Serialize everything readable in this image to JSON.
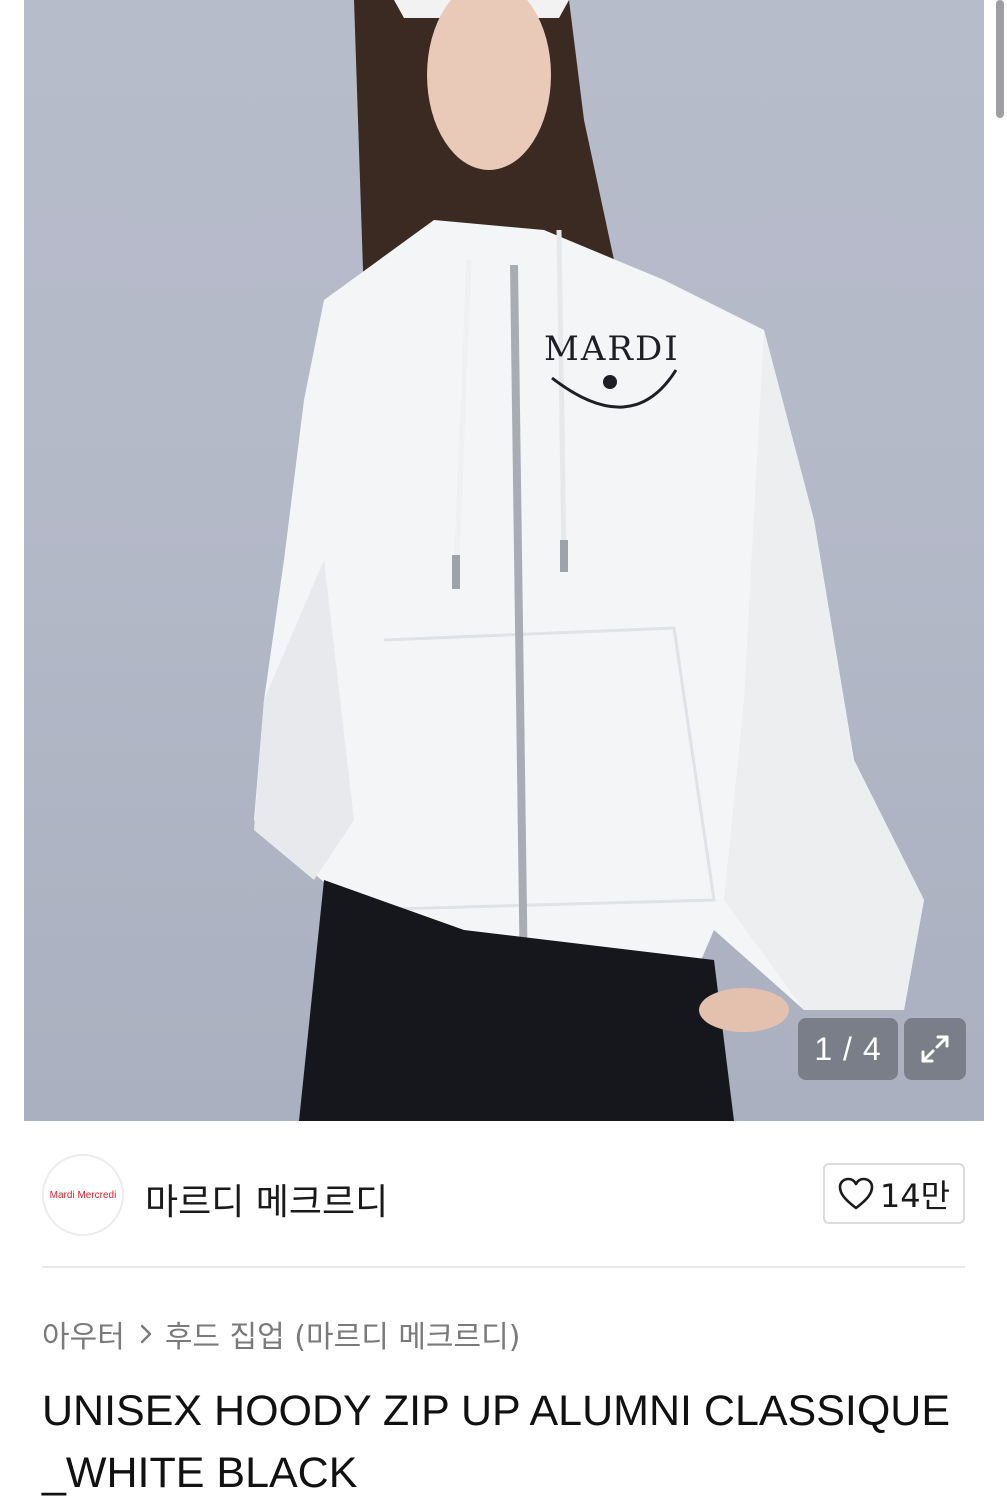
{
  "gallery": {
    "current": "1",
    "total": "4",
    "counter_text": "1 / 4",
    "expand_icon": "expand-icon",
    "print_text": "MARDI"
  },
  "brand": {
    "logo_text": "Mardi Mercredi",
    "name": "마르디 메크르디",
    "likes": "14만",
    "like_icon": "heart-icon"
  },
  "breadcrumb": {
    "category": "아우터",
    "subcategory": "후드 집업 (마르디 메크르디)",
    "separator_icon": "chevron-right-icon"
  },
  "product": {
    "title": "UNISEX HOODY ZIP UP ALUMNI CLASSIQUE_WHITE BLACK"
  },
  "colors": {
    "brand_logo_red": "#e0202c",
    "overlay": "#6e737d"
  }
}
